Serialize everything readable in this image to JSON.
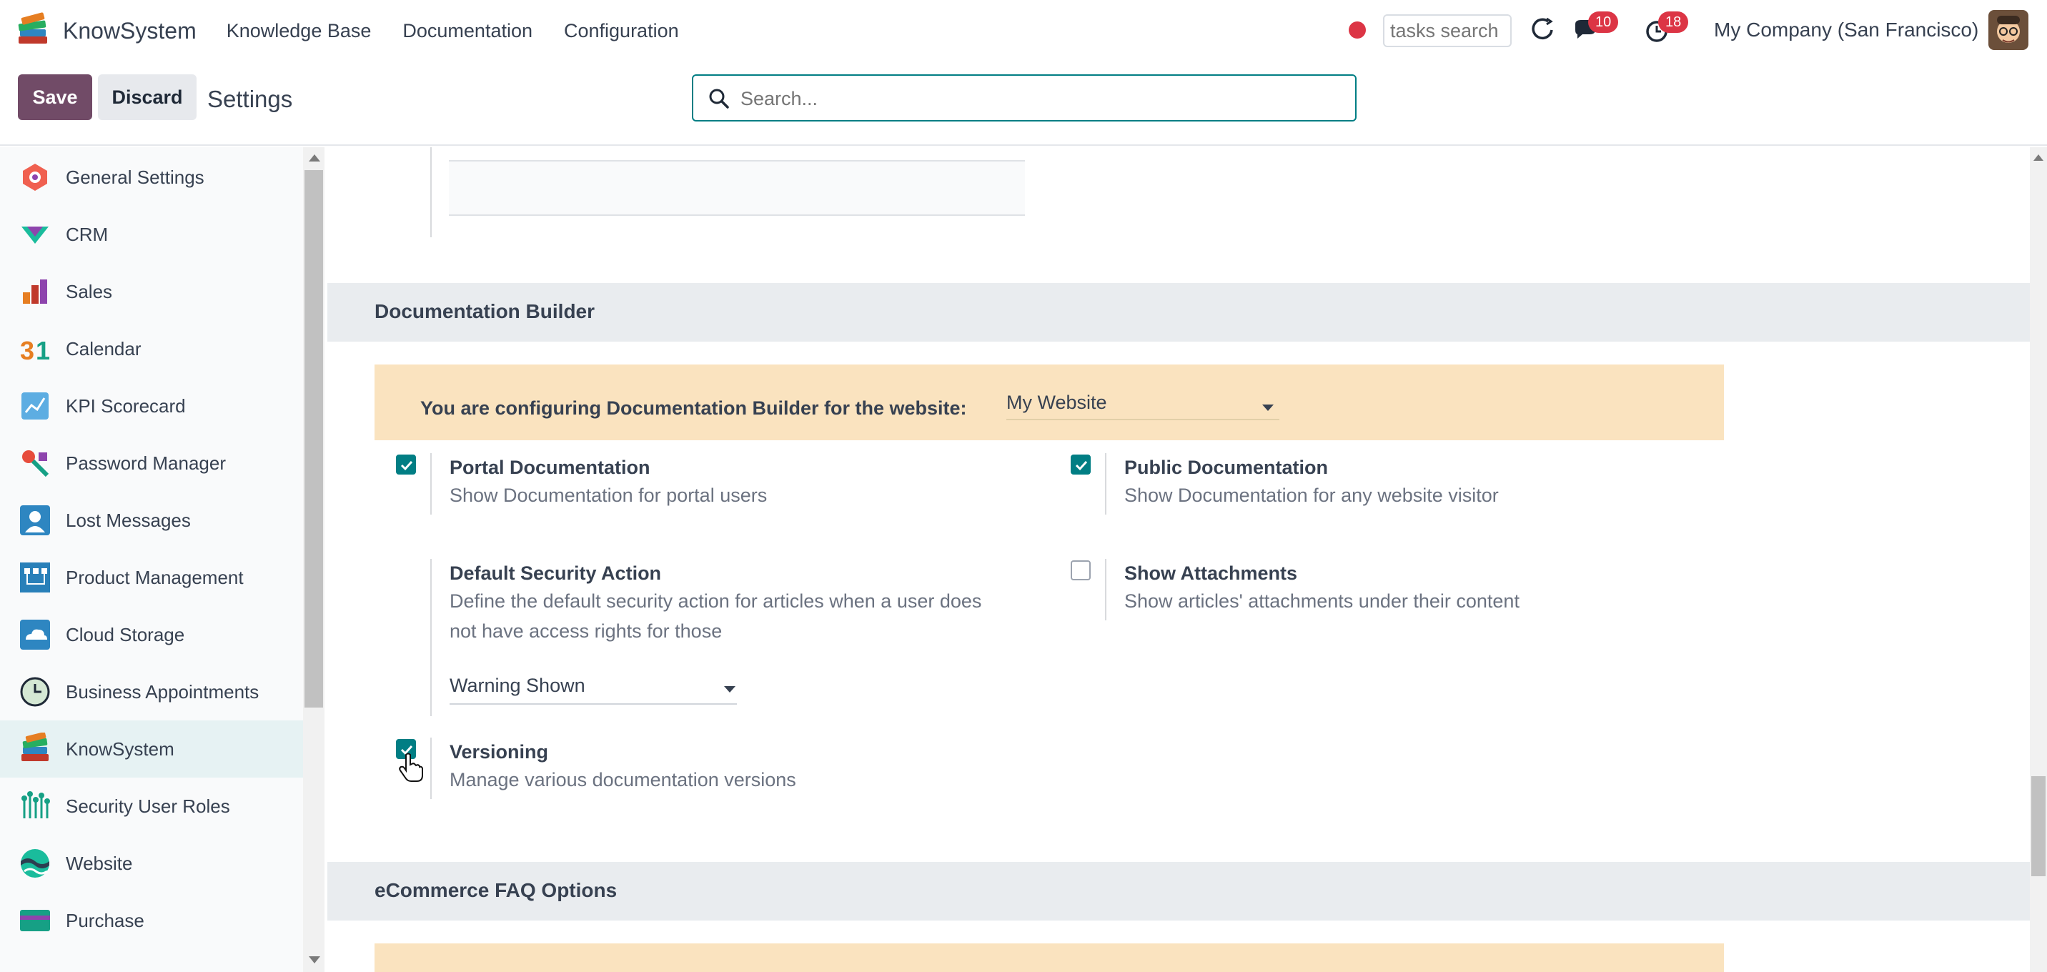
{
  "app": {
    "name": "KnowSystem",
    "nav": [
      "Knowledge Base",
      "Documentation",
      "Configuration"
    ],
    "tasks_search_placeholder": "tasks search",
    "messages_badge": "10",
    "activities_badge": "18",
    "company": "My Company (San Francisco)"
  },
  "control": {
    "save_label": "Save",
    "discard_label": "Discard",
    "title": "Settings",
    "search_placeholder": "Search..."
  },
  "sidebar": {
    "items": [
      {
        "label": "General Settings",
        "icon": "general-settings-icon"
      },
      {
        "label": "CRM",
        "icon": "crm-icon"
      },
      {
        "label": "Sales",
        "icon": "sales-icon"
      },
      {
        "label": "Calendar",
        "icon": "calendar-icon"
      },
      {
        "label": "KPI Scorecard",
        "icon": "kpi-scorecard-icon"
      },
      {
        "label": "Password Manager",
        "icon": "password-manager-icon"
      },
      {
        "label": "Lost Messages",
        "icon": "lost-messages-icon"
      },
      {
        "label": "Product Management",
        "icon": "product-management-icon"
      },
      {
        "label": "Cloud Storage",
        "icon": "cloud-storage-icon"
      },
      {
        "label": "Business Appointments",
        "icon": "business-appointments-icon"
      },
      {
        "label": "KnowSystem",
        "icon": "knowsystem-icon",
        "active": true
      },
      {
        "label": "Security User Roles",
        "icon": "security-user-roles-icon"
      },
      {
        "label": "Website",
        "icon": "website-icon"
      },
      {
        "label": "Purchase",
        "icon": "purchase-icon"
      }
    ]
  },
  "documentation_builder": {
    "heading": "Documentation Builder",
    "website_prompt": "You are configuring Documentation Builder for the website:",
    "website_value": "My Website",
    "options": {
      "portal": {
        "title": "Portal Documentation",
        "desc": "Show Documentation for portal users",
        "checked": true
      },
      "public": {
        "title": "Public Documentation",
        "desc": "Show Documentation for any website visitor",
        "checked": true
      },
      "security": {
        "title": "Default Security Action",
        "desc_line1": "Define the default security action for articles when a user does",
        "desc_line2": "not have access rights for those",
        "value": "Warning Shown"
      },
      "attachments": {
        "title": "Show Attachments",
        "desc": "Show articles' attachments under their content",
        "checked": false
      },
      "versioning": {
        "title": "Versioning",
        "desc": "Manage various documentation versions",
        "checked": true
      }
    }
  },
  "ecommerce": {
    "heading": "eCommerce FAQ Options"
  },
  "colors": {
    "primary": "#714b67",
    "accent": "#017e84",
    "banner": "#fae3bf",
    "badge": "#dc3545"
  }
}
